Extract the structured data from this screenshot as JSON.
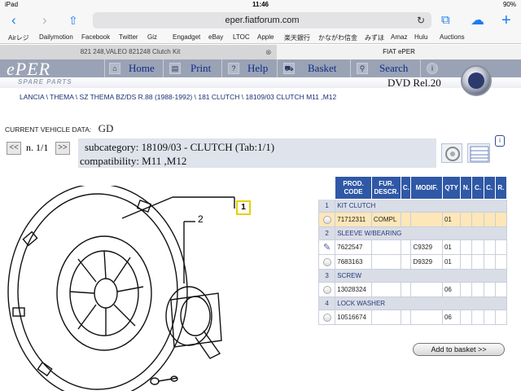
{
  "status": {
    "device": "iPad",
    "wifi": "",
    "time": "11:46",
    "battery": "90%"
  },
  "toolbar": {
    "back": "‹",
    "forward": "›",
    "share": "⇧",
    "url": "eper.fiatforum.com",
    "reload": "↻",
    "book": "⧉",
    "cloud": "☁",
    "add": "+"
  },
  "bookmarks": [
    "Airレジ",
    "Dailymotion",
    "Facebook",
    "Twitter",
    "Giz",
    "Engadget",
    "eBay",
    "LTOC",
    "Apple",
    "楽天銀行",
    "かながわ信金",
    "みずほ",
    "Amaz",
    "Hulu",
    "Auctions"
  ],
  "tabs": {
    "left": "821 248,VALEO 821248 Clutch Kit",
    "right": "FIAT ePER",
    "close": "⊗"
  },
  "eper": {
    "logo": "ePER",
    "spare_parts": "SPARE PARTS",
    "nav": {
      "home": "Home",
      "print": "Print",
      "help": "Help",
      "basket": "Basket",
      "search": "Search"
    },
    "nav_icons": {
      "home": "⌂",
      "print": "▤",
      "help": "?",
      "basket": "⛟",
      "search": "⚲",
      "info": "i"
    },
    "dvd": "DVD Rel.20"
  },
  "breadcrumb": "LANCIA \\ THEMA \\ SZ THEMA BZ/DS R.88 (1988-1992) \\ 181 CLUTCH \\ 18109/03 CLUTCH M11 ,M12",
  "vehicle": {
    "label": "CURRENT VEHICLE DATA:",
    "value": "GD"
  },
  "pager": {
    "prev": "<<",
    "next": ">>",
    "text": "n. 1/1"
  },
  "subcategory": {
    "line1": "subcategory:  18109/03 - CLUTCH (Tab:1/1)",
    "line2": "compatibility:  M11 ,M12"
  },
  "table": {
    "headers": [
      "",
      "PROD. CODE",
      "FUR. DESCR.",
      "C.",
      "MODIF.",
      "QTY",
      "N.",
      "C.",
      "C.",
      "R."
    ],
    "rows": [
      {
        "type": "group",
        "num": "1",
        "label": "KIT CLUTCH"
      },
      {
        "type": "part",
        "code": "71712311",
        "descr": "COMPL",
        "modif": "",
        "qty": "01",
        "selected": true
      },
      {
        "type": "group",
        "num": "2",
        "label": "SLEEVE W/BEARING"
      },
      {
        "type": "part",
        "code": "7622547",
        "descr": "",
        "modif": "C9329",
        "qty": "01",
        "edit": true
      },
      {
        "type": "part",
        "code": "7683163",
        "descr": "",
        "modif": "D9329",
        "qty": "01"
      },
      {
        "type": "group",
        "num": "3",
        "label": "SCREW"
      },
      {
        "type": "part",
        "code": "13028324",
        "descr": "",
        "modif": "",
        "qty": "06"
      },
      {
        "type": "group",
        "num": "4",
        "label": "LOCK WASHER"
      },
      {
        "type": "part",
        "code": "10516674",
        "descr": "",
        "modif": "",
        "qty": "06"
      }
    ]
  },
  "add_to_basket": "Add to basket >>",
  "diagram": {
    "callout1": "1",
    "callout2": "2"
  }
}
